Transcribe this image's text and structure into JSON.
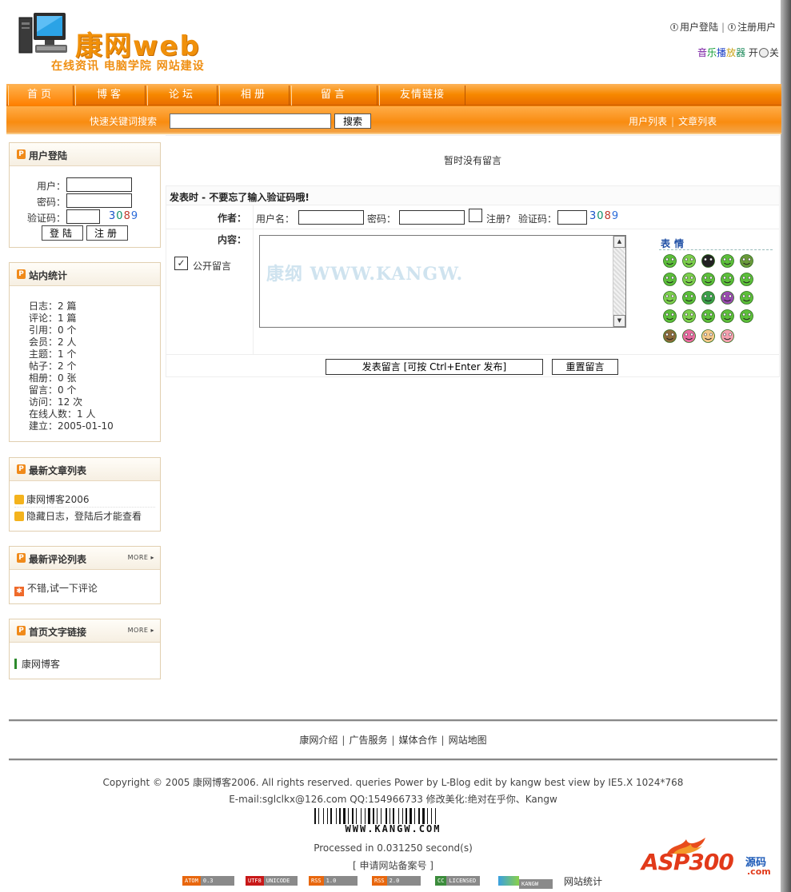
{
  "header": {
    "logo_title": "康网web",
    "logo_tagline": "在线资讯 电脑学院 网站建设",
    "user_login": "用户登陆",
    "register_user": "注册用户",
    "music_chars": [
      "音",
      "乐",
      "播",
      "放",
      "器"
    ],
    "music_on": "开",
    "music_off": "关"
  },
  "nav": {
    "tabs": [
      "首页",
      "博客",
      "论坛",
      "相册",
      "留言",
      "友情链接"
    ],
    "active_tab": "首页",
    "search_label": "快速关键词搜索",
    "search_value": "",
    "search_button": "搜索",
    "user_list": "用户列表",
    "article_list": "文章列表"
  },
  "sidebar": {
    "login": {
      "title": "用户登陆",
      "user_label": "用户：",
      "password_label": "密码：",
      "captcha_label": "验证码：",
      "captcha_digits": [
        "3",
        "0",
        "8",
        "9"
      ],
      "login_button": "登陆",
      "register_button": "注册"
    },
    "stats": {
      "title": "站内统计",
      "lines": [
        "日志：2 篇",
        "评论：1 篇",
        "引用：0 个",
        "会员：2 人",
        "主题：1 个",
        "帖子：2 个",
        "相册：0 张",
        "留言：0 个",
        "访问：12 次",
        "在线人数：1 人",
        "建立：2005-01-10"
      ]
    },
    "latest_articles": {
      "title": "最新文章列表",
      "items": [
        "康网博客2006",
        "隐藏日志，登陆后才能查看"
      ]
    },
    "latest_comments": {
      "title": "最新评论列表",
      "more": "MORE",
      "items": [
        "不错,试一下评论"
      ]
    },
    "text_links": {
      "title": "首页文字链接",
      "more": "MORE",
      "items": [
        "康网博客"
      ]
    }
  },
  "main": {
    "no_messages": "暂时没有留言",
    "form": {
      "title": "发表时 - 不要忘了输入验证码哦!",
      "author_label": "作者：",
      "username_label": "用户名：",
      "password_label": "密码：",
      "register_label": "注册?",
      "captcha_label": "验证码：",
      "captcha_digits": [
        "3",
        "0",
        "8",
        "9"
      ],
      "content_label": "内容：",
      "public_label": "公开留言",
      "public_checked": true,
      "register_checked": false,
      "watermark": "康纲 WWW.KANGW.",
      "emoticons_title": "表情",
      "submit_button": "发表留言 [可按 Ctrl+Enter 发布]",
      "reset_button": "重置留言"
    }
  },
  "footer": {
    "links": [
      "康网介绍",
      "广告服务",
      "媒体合作",
      "网站地图"
    ],
    "copyright": "Copyright © 2005 康网博客2006. All rights reserved. queries Power by L-Blog edit by kangw best view by IE5.X 1024*768",
    "contact": "E-mail:sglclkx@126.com QQ:154966733 修改美化:绝对在乎你、Kangw",
    "barcode_text": "WWW.KANGW.COM",
    "processed": "Processed in 0.031250 second(s)",
    "icp": "[ 申请网站备案号 ]",
    "badges": [
      {
        "left": "ATOM",
        "right": "0.3",
        "color": "#e8670e"
      },
      {
        "left": "UTF8",
        "right": "UNICODE",
        "color": "#c81818"
      },
      {
        "left": "RSS",
        "right": "1.0",
        "color": "#e8670e"
      },
      {
        "left": "RSS",
        "right": "2.0",
        "color": "#e8670e"
      },
      {
        "left": "CC",
        "right": "LICENSED",
        "color": "#3c8c3c"
      },
      {
        "left": "",
        "right": "KANGW",
        "color": "#2c6bb8"
      }
    ],
    "site_stats": "网站统计",
    "asp_logo_main": "ASP300",
    "asp_logo_sub": "源码",
    "asp_logo_com": ".com"
  },
  "colors": {
    "nav_orange": "#f78800",
    "accent_text": "#ef8f13",
    "emote_title": "#1f4fa5"
  }
}
